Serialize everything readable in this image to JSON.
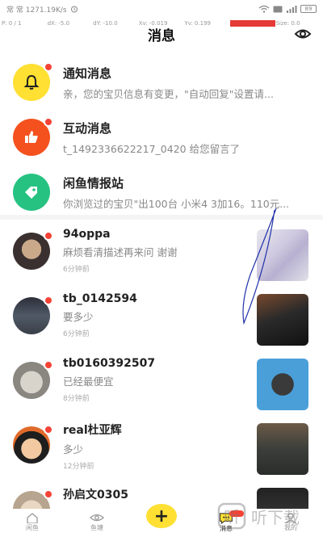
{
  "status_bar": {
    "left_text": "常 常 1271.19K/s",
    "battery": "89"
  },
  "debug_bar": [
    "P: 0 / 1",
    "dX: -5.0",
    "dY: -10.0",
    "Xv: -0.019",
    "Yv: 0.199",
    "Pr: 1.0",
    "Size: 0.0"
  ],
  "header": {
    "title": "消息"
  },
  "system_items": [
    {
      "title": "通知消息",
      "subtitle": "亲，您的宝贝信息有变更，\"自动回复\"设置请...",
      "icon": "bell-icon",
      "color": "#ffe033"
    },
    {
      "title": "互动消息",
      "subtitle": "t_1492336622217_0420 给您留言了",
      "icon": "thumbs-up-icon",
      "color": "#f4511e"
    },
    {
      "title": "闲鱼情报站",
      "subtitle": "你浏览过的宝贝\"出100台 小米4 3加16。110元...",
      "icon": "tag-icon",
      "color": "#26c281"
    }
  ],
  "chats": [
    {
      "name": "94oppa",
      "message": "麻烦看清描述再来问 谢谢",
      "time": "6分钟前"
    },
    {
      "name": "tb_0142594",
      "message": "要多少",
      "time": "6分钟前"
    },
    {
      "name": "tb0160392507",
      "message": "已经最便宜",
      "time": "8分钟前"
    },
    {
      "name": "real杜亚辉",
      "message": "多少",
      "time": "12分钟前"
    },
    {
      "name": "孙启文0305",
      "message": "",
      "time": ""
    }
  ],
  "tabs": [
    {
      "label": "闲鱼",
      "icon": "home-icon"
    },
    {
      "label": "鱼塘",
      "icon": "eye-icon"
    },
    {
      "label": "",
      "icon": "plus-icon"
    },
    {
      "label": "消息",
      "icon": "message-icon"
    },
    {
      "label": "我的",
      "icon": "user-icon"
    }
  ],
  "watermark": "听下载",
  "colors": {
    "accent_yellow": "#ffe033",
    "badge_red": "#f44336"
  }
}
